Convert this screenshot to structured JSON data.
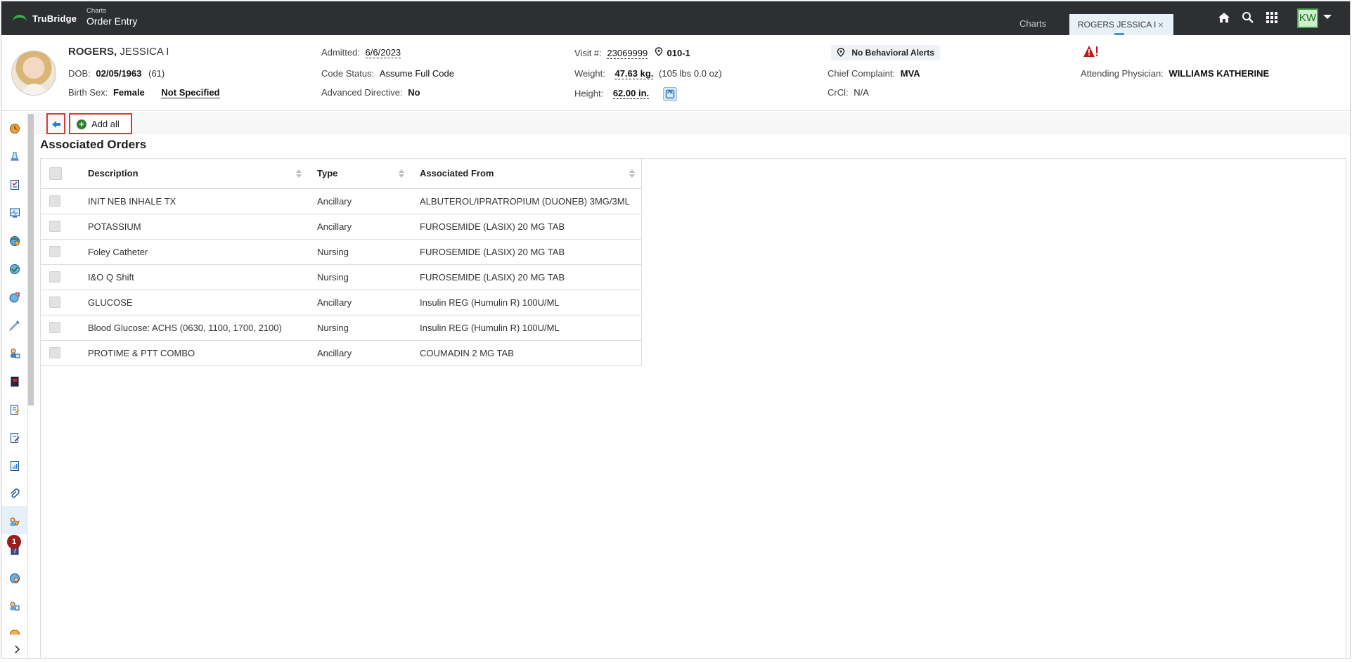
{
  "header": {
    "brand": "TruBridge",
    "app_sub": "Charts",
    "app_title": "Order Entry",
    "tabs": [
      {
        "label": "Charts"
      },
      {
        "label": "ROGERS JESSICA I"
      }
    ],
    "close_glyph": "×",
    "icons": [
      "home-icon",
      "search-icon",
      "apps-grid-icon"
    ],
    "user_initials": "KW"
  },
  "patient": {
    "last_name": "ROGERS,",
    "first_name": "JESSICA I",
    "dob_label": "DOB:",
    "dob": "02/05/1963",
    "age": "(61)",
    "birth_sex_label": "Birth Sex:",
    "birth_sex": "Female",
    "gender_identity": "Not Specified",
    "admitted_label": "Admitted:",
    "admitted": "6/6/2023",
    "code_status_label": "Code Status:",
    "code_status": "Assume Full Code",
    "adv_directive_label": "Advanced Directive:",
    "adv_directive": "No",
    "visit_label": "Visit #:",
    "visit": "23069999",
    "room": "010-1",
    "weight_label": "Weight:",
    "weight": "47.63 kg.",
    "weight_alt": "(105 lbs 0.0 oz)",
    "height_label": "Height:",
    "height": "62.00 in.",
    "behavioral_alerts": "No Behavioral Alerts",
    "chief_complaint_label": "Chief Complaint:",
    "chief_complaint": "MVA",
    "crcl_label": "CrCl:",
    "crcl": "N/A",
    "attending_label": "Attending Physician:",
    "attending": "WILLIAMS KATHERINE"
  },
  "toolbar": {
    "add_all_label": "Add all"
  },
  "section_title": "Associated Orders",
  "table": {
    "columns": [
      "Description",
      "Type",
      "Associated From"
    ],
    "rows": [
      {
        "description": "INIT NEB INHALE TX",
        "type": "Ancillary",
        "from": "ALBUTEROL/IPRATROPIUM (DUONEB) 3MG/3ML"
      },
      {
        "description": "POTASSIUM",
        "type": "Ancillary",
        "from": "FUROSEMIDE (LASIX) 20 MG TAB"
      },
      {
        "description": "Foley Catheter",
        "type": "Nursing",
        "from": "FUROSEMIDE (LASIX) 20 MG TAB"
      },
      {
        "description": "I&O Q Shift",
        "type": "Nursing",
        "from": "FUROSEMIDE (LASIX) 20 MG TAB"
      },
      {
        "description": "GLUCOSE",
        "type": "Ancillary",
        "from": "Insulin REG (Humulin R) 100U/ML"
      },
      {
        "description": "Blood Glucose: ACHS (0630, 1100, 1700, 2100)",
        "type": "Nursing",
        "from": "Insulin REG (Humulin R) 100U/ML"
      },
      {
        "description": "PROTIME & PTT COMBO",
        "type": "Ancillary",
        "from": "COUMADIN 2 MG TAB"
      }
    ]
  },
  "sidebar": {
    "badge_count": "1",
    "colors": {
      "accent": "#4a90d9",
      "badge": "#9b1c1c",
      "highlight": "#d83a3a"
    }
  }
}
